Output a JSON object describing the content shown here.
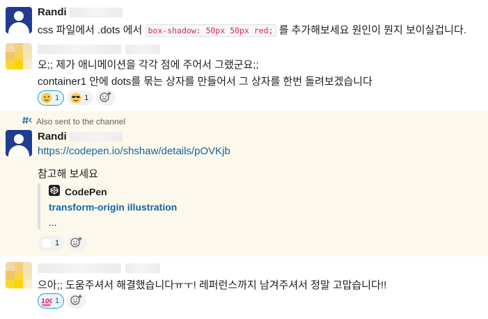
{
  "messages": [
    {
      "author": "Randi",
      "text_before_code": "css 파일에서 .dots 에서",
      "code": "box-shadow: 50px 50px red;",
      "text_after_code": "를 추가해보세요 원인이 뭔지 보이실겁니다."
    },
    {
      "lines": [
        "오;; 제가 애니메이션을 각각 점에 주어서 그랬군요;;",
        "container1 안에 dots를 묶는 상자를 만들어서 그 상자를 한번 돌려보겠습니다"
      ],
      "reactions": [
        {
          "emoji_icon": "wink-face-icon",
          "count": "1",
          "active": true
        },
        {
          "emoji_icon": "sunglasses-face-icon",
          "count": "1",
          "active": false
        }
      ]
    },
    {
      "also_sent": "Also sent to the channel",
      "author": "Randi",
      "link": "https://codepen.io/shshaw/details/pOVKjb",
      "text": "참고해 보세요",
      "attachment": {
        "service": "CodePen",
        "title": "transform-origin illustration",
        "ellipsis": "..."
      },
      "reactions": [
        {
          "emoji_icon": "white-square-icon",
          "count": "1",
          "active": false
        }
      ]
    },
    {
      "text": "으아;; 도움주셔서 해결했습니다ㅠㅜ! 레퍼런스까지 남겨주셔서 정말 고맙습니다!!",
      "reactions": [
        {
          "emoji_icon": "hundred-points-icon",
          "count": "1",
          "active": true
        }
      ]
    }
  ],
  "colors": {
    "link": "#1264a3",
    "code": "#e01e5a",
    "thread_highlight": "#fdf8ec",
    "randi_avatar": "#1f3c91"
  }
}
